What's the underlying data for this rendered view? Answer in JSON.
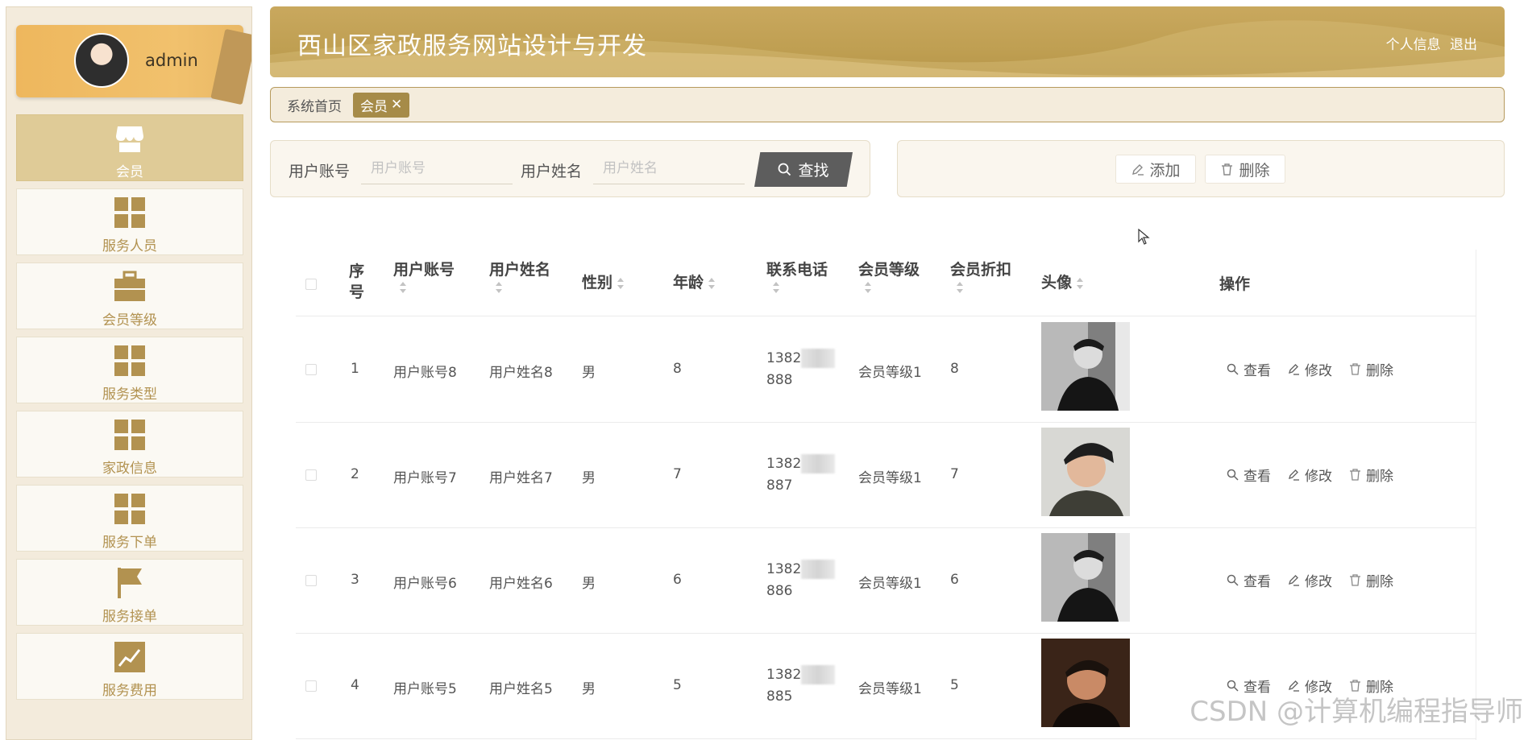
{
  "sidebar": {
    "username": "admin",
    "items": [
      {
        "label": "会员",
        "icon": "store-icon",
        "active": true
      },
      {
        "label": "服务人员",
        "icon": "grid-icon",
        "active": false
      },
      {
        "label": "会员等级",
        "icon": "briefcase-icon",
        "active": false
      },
      {
        "label": "服务类型",
        "icon": "grid-icon",
        "active": false
      },
      {
        "label": "家政信息",
        "icon": "grid-icon",
        "active": false
      },
      {
        "label": "服务下单",
        "icon": "grid-icon",
        "active": false
      },
      {
        "label": "服务接单",
        "icon": "flag-icon",
        "active": false
      },
      {
        "label": "服务费用",
        "icon": "chart-icon",
        "active": false
      }
    ]
  },
  "header": {
    "title": "西山区家政服务网站设计与开发",
    "profile_link": "个人信息",
    "logout_link": "退出"
  },
  "breadcrumb": {
    "home": "系统首页",
    "tag": "会员",
    "tag_close": "✕"
  },
  "search": {
    "account_label": "用户账号",
    "account_placeholder": "用户账号",
    "name_label": "用户姓名",
    "name_placeholder": "用户姓名",
    "button_label": "查找"
  },
  "actions": {
    "add_label": "添加",
    "delete_label": "删除"
  },
  "table": {
    "columns": {
      "index_line1": "序",
      "index_line2": "号",
      "account": "用户账号",
      "name": "用户姓名",
      "gender": "性别",
      "age": "年龄",
      "phone": "联系电话",
      "level": "会员等级",
      "discount": "会员折扣",
      "avatar": "头像",
      "operations": "操作"
    },
    "rows": [
      {
        "index": "1",
        "account": "用户账号8",
        "name": "用户姓名8",
        "gender": "男",
        "age": "8",
        "phone_prefix": "1382",
        "phone_suffix": "888",
        "level": "会员等级1",
        "discount": "8",
        "view": "查看",
        "edit": "修改",
        "delete": "删除"
      },
      {
        "index": "2",
        "account": "用户账号7",
        "name": "用户姓名7",
        "gender": "男",
        "age": "7",
        "phone_prefix": "1382",
        "phone_suffix": "887",
        "level": "会员等级1",
        "discount": "7",
        "view": "查看",
        "edit": "修改",
        "delete": "删除"
      },
      {
        "index": "3",
        "account": "用户账号6",
        "name": "用户姓名6",
        "gender": "男",
        "age": "6",
        "phone_prefix": "1382",
        "phone_suffix": "886",
        "level": "会员等级1",
        "discount": "6",
        "view": "查看",
        "edit": "修改",
        "delete": "删除"
      },
      {
        "index": "4",
        "account": "用户账号5",
        "name": "用户姓名5",
        "gender": "男",
        "age": "5",
        "phone_prefix": "1382",
        "phone_suffix": "885",
        "level": "会员等级1",
        "discount": "5",
        "view": "查看",
        "edit": "修改",
        "delete": "删除"
      }
    ]
  },
  "watermark": "CSDN @计算机编程指导师",
  "colors": {
    "accent": "#bf9f52",
    "sidebar_bg": "#f3ebdc",
    "nav_active": "#dfcb97",
    "nav_text": "#b29250",
    "search_button": "#5d5d5d"
  }
}
